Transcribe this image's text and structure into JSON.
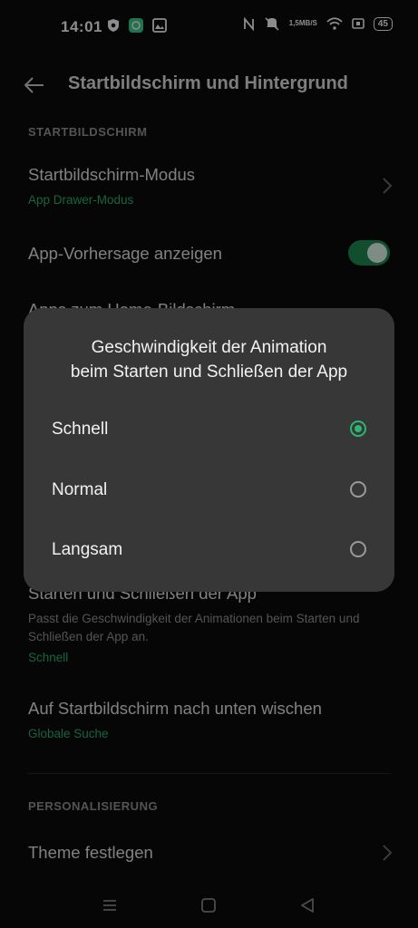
{
  "status_bar": {
    "time": "14:01",
    "speed_value": "1,5",
    "speed_unit": "MB/S",
    "battery": "45"
  },
  "header": {
    "title": "Startbildschirm und Hintergrund"
  },
  "sections": {
    "home": "STARTBILDSCHIRM",
    "personal": "PERSONALISIERUNG"
  },
  "rows": {
    "home_mode_title": "Startbildschirm-Modus",
    "home_mode_value": "App Drawer-Modus",
    "app_suggest_title": "App-Vorhersage anzeigen",
    "add_apps_title": "Apps zum Home-Bildschirm",
    "anim_title": "Starten und Schließen der App",
    "anim_desc": "Passt die Geschwindigkeit der Animationen beim Starten und Schließen der App an.",
    "anim_value": "Schnell",
    "swipe_title": "Auf Startbildschirm nach unten wischen",
    "swipe_value": "Globale Suche",
    "theme_title": "Theme festlegen"
  },
  "dialog": {
    "title_line1": "Geschwindigkeit der Animation",
    "title_line2": "beim Starten und Schließen der App",
    "options": [
      {
        "label": "Schnell",
        "selected": true
      },
      {
        "label": "Normal",
        "selected": false
      },
      {
        "label": "Langsam",
        "selected": false
      }
    ]
  },
  "colors": {
    "accent": "#2bb673",
    "dialog_bg": "#373737",
    "bg": "#0b0b0b"
  }
}
